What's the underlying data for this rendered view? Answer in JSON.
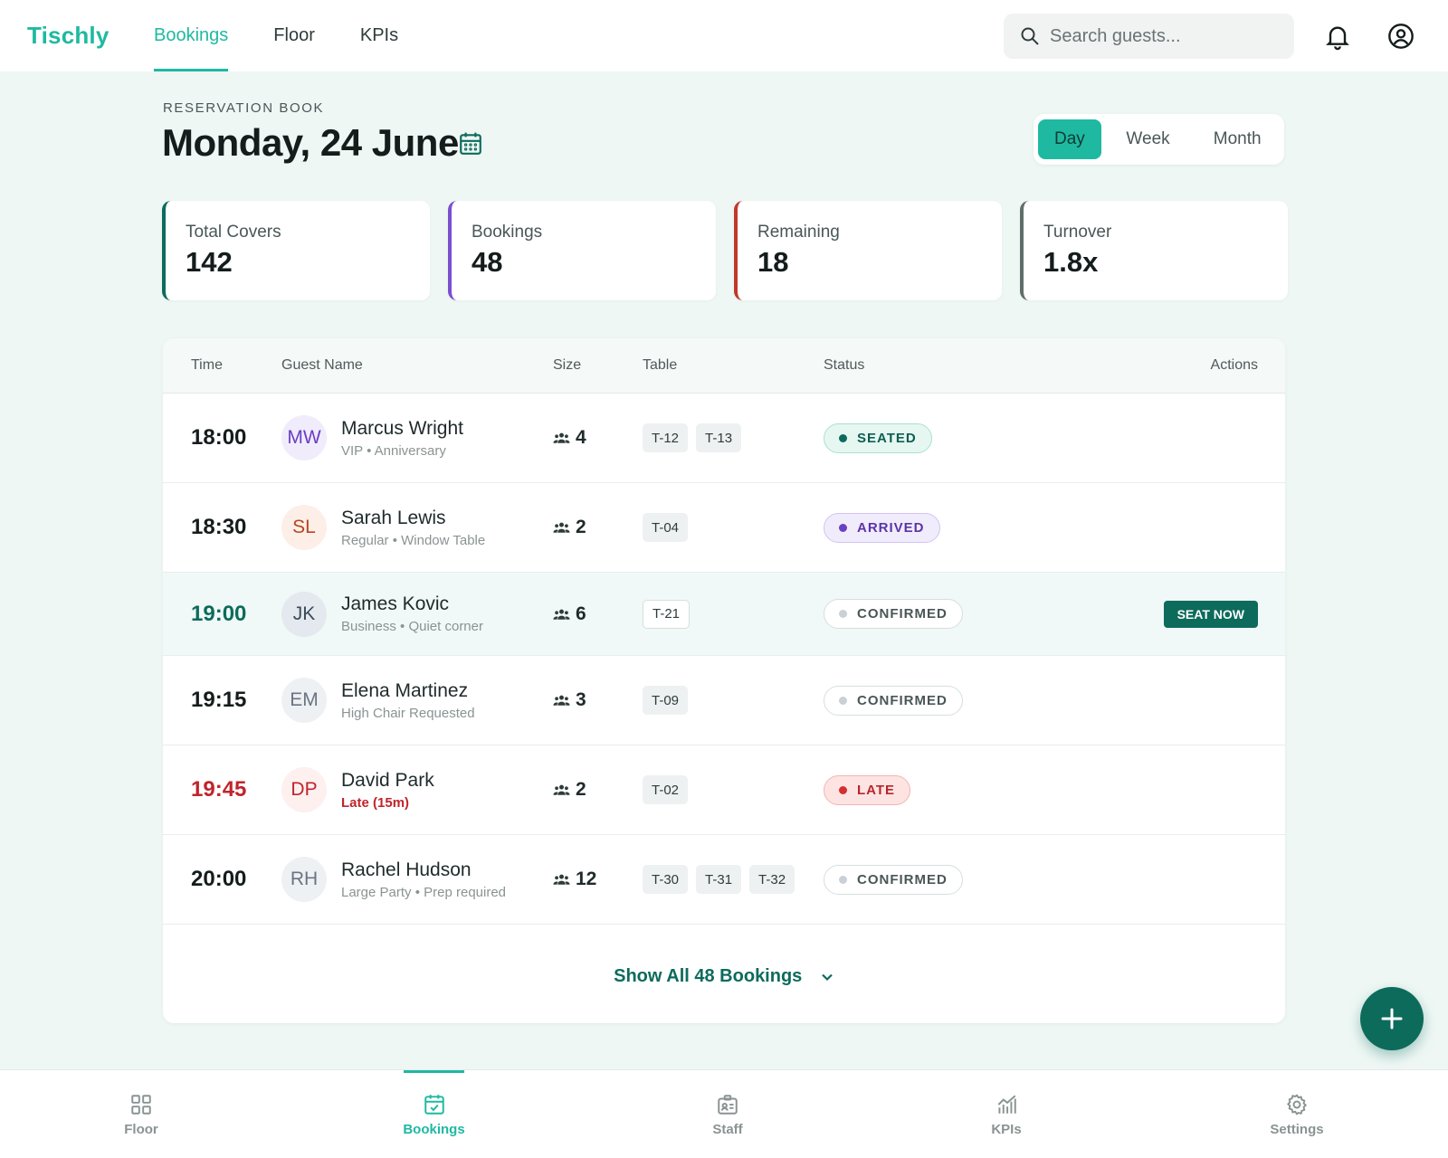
{
  "app": {
    "name": "Tischly"
  },
  "topnav": [
    {
      "label": "Bookings",
      "active": true
    },
    {
      "label": "Floor",
      "active": false
    },
    {
      "label": "KPIs",
      "active": false
    }
  ],
  "search": {
    "placeholder": "Search guests..."
  },
  "header": {
    "eyebrow": "RESERVATION BOOK",
    "title": "Monday, 24 June"
  },
  "view_toggle": [
    {
      "label": "Day",
      "active": true
    },
    {
      "label": "Week",
      "active": false
    },
    {
      "label": "Month",
      "active": false
    }
  ],
  "stats": [
    {
      "label": "Total Covers",
      "value": "142",
      "accent": "#0d6b5c"
    },
    {
      "label": "Bookings",
      "value": "48",
      "accent": "#7b4fd1"
    },
    {
      "label": "Remaining",
      "value": "18",
      "accent": "#c0392b"
    },
    {
      "label": "Turnover",
      "value": "1.8x",
      "accent": "#5f6e6a"
    }
  ],
  "table": {
    "headers": {
      "time": "Time",
      "guest": "Guest Name",
      "size": "Size",
      "table": "Table",
      "status": "Status",
      "actions": "Actions"
    },
    "rows": [
      {
        "time": "18:00",
        "initials": "MW",
        "name": "Marcus Wright",
        "note": "VIP • Anniversary",
        "size": "4",
        "tables": [
          "T-12",
          "T-13"
        ],
        "status": "SEATED"
      },
      {
        "time": "18:30",
        "initials": "SL",
        "name": "Sarah Lewis",
        "note": "Regular • Window Table",
        "size": "2",
        "tables": [
          "T-04"
        ],
        "status": "ARRIVED"
      },
      {
        "time": "19:00",
        "initials": "JK",
        "name": "James Kovic",
        "note": "Business • Quiet corner",
        "size": "6",
        "tables": [
          "T-21"
        ],
        "status": "CONFIRMED",
        "action": "SEAT NOW"
      },
      {
        "time": "19:15",
        "initials": "EM",
        "name": "Elena Martinez",
        "note": "High Chair Requested",
        "size": "3",
        "tables": [
          "T-09"
        ],
        "status": "CONFIRMED"
      },
      {
        "time": "19:45",
        "initials": "DP",
        "name": "David Park",
        "note": "Late (15m)",
        "size": "2",
        "tables": [
          "T-02"
        ],
        "status": "LATE"
      },
      {
        "time": "20:00",
        "initials": "RH",
        "name": "Rachel Hudson",
        "note": "Large Party • Prep required",
        "size": "12",
        "tables": [
          "T-30",
          "T-31",
          "T-32"
        ],
        "status": "CONFIRMED"
      }
    ],
    "show_all": "Show All 48 Bookings"
  },
  "bottomnav": [
    {
      "label": "Floor",
      "icon": "grid-icon",
      "active": false
    },
    {
      "label": "Bookings",
      "icon": "calendar-check-icon",
      "active": true
    },
    {
      "label": "Staff",
      "icon": "id-badge-icon",
      "active": false
    },
    {
      "label": "KPIs",
      "icon": "chart-icon",
      "active": false
    },
    {
      "label": "Settings",
      "icon": "gear-icon",
      "active": false
    }
  ],
  "colors": {
    "brand": "#1fb9a1",
    "primary_dark": "#0d6b5c",
    "late": "#c0392b",
    "arrived": "#7b4fd1"
  }
}
